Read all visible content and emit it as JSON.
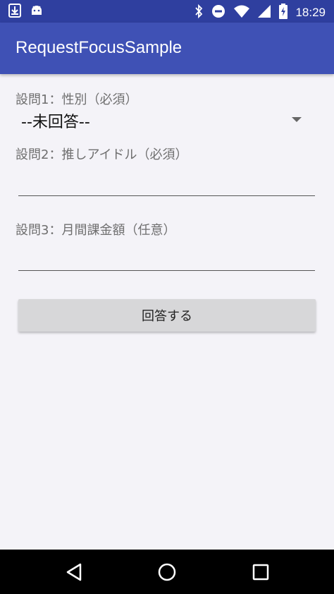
{
  "status_bar": {
    "time": "18:29",
    "left_icons": [
      "download-icon",
      "android-icon"
    ],
    "right_icons": [
      "bluetooth-icon",
      "do-not-disturb-icon",
      "wifi-icon",
      "signal-icon",
      "battery-charging-icon"
    ]
  },
  "app_bar": {
    "title": "RequestFocusSample"
  },
  "form": {
    "q1": {
      "label": "設問1：性別（必須）",
      "selected": "--未回答--"
    },
    "q2": {
      "label": "設問2：推しアイドル（必須）",
      "value": ""
    },
    "q3": {
      "label": "設問3：月間課金額（任意）",
      "value": ""
    },
    "submit_label": "回答する"
  },
  "nav_bar": {
    "icons": [
      "back-icon",
      "home-icon",
      "recents-icon"
    ]
  },
  "colors": {
    "status_bar": "#2f3f9f",
    "app_bar": "#3f51b5",
    "background": "#f4f3f8",
    "button": "#d7d7d9"
  }
}
